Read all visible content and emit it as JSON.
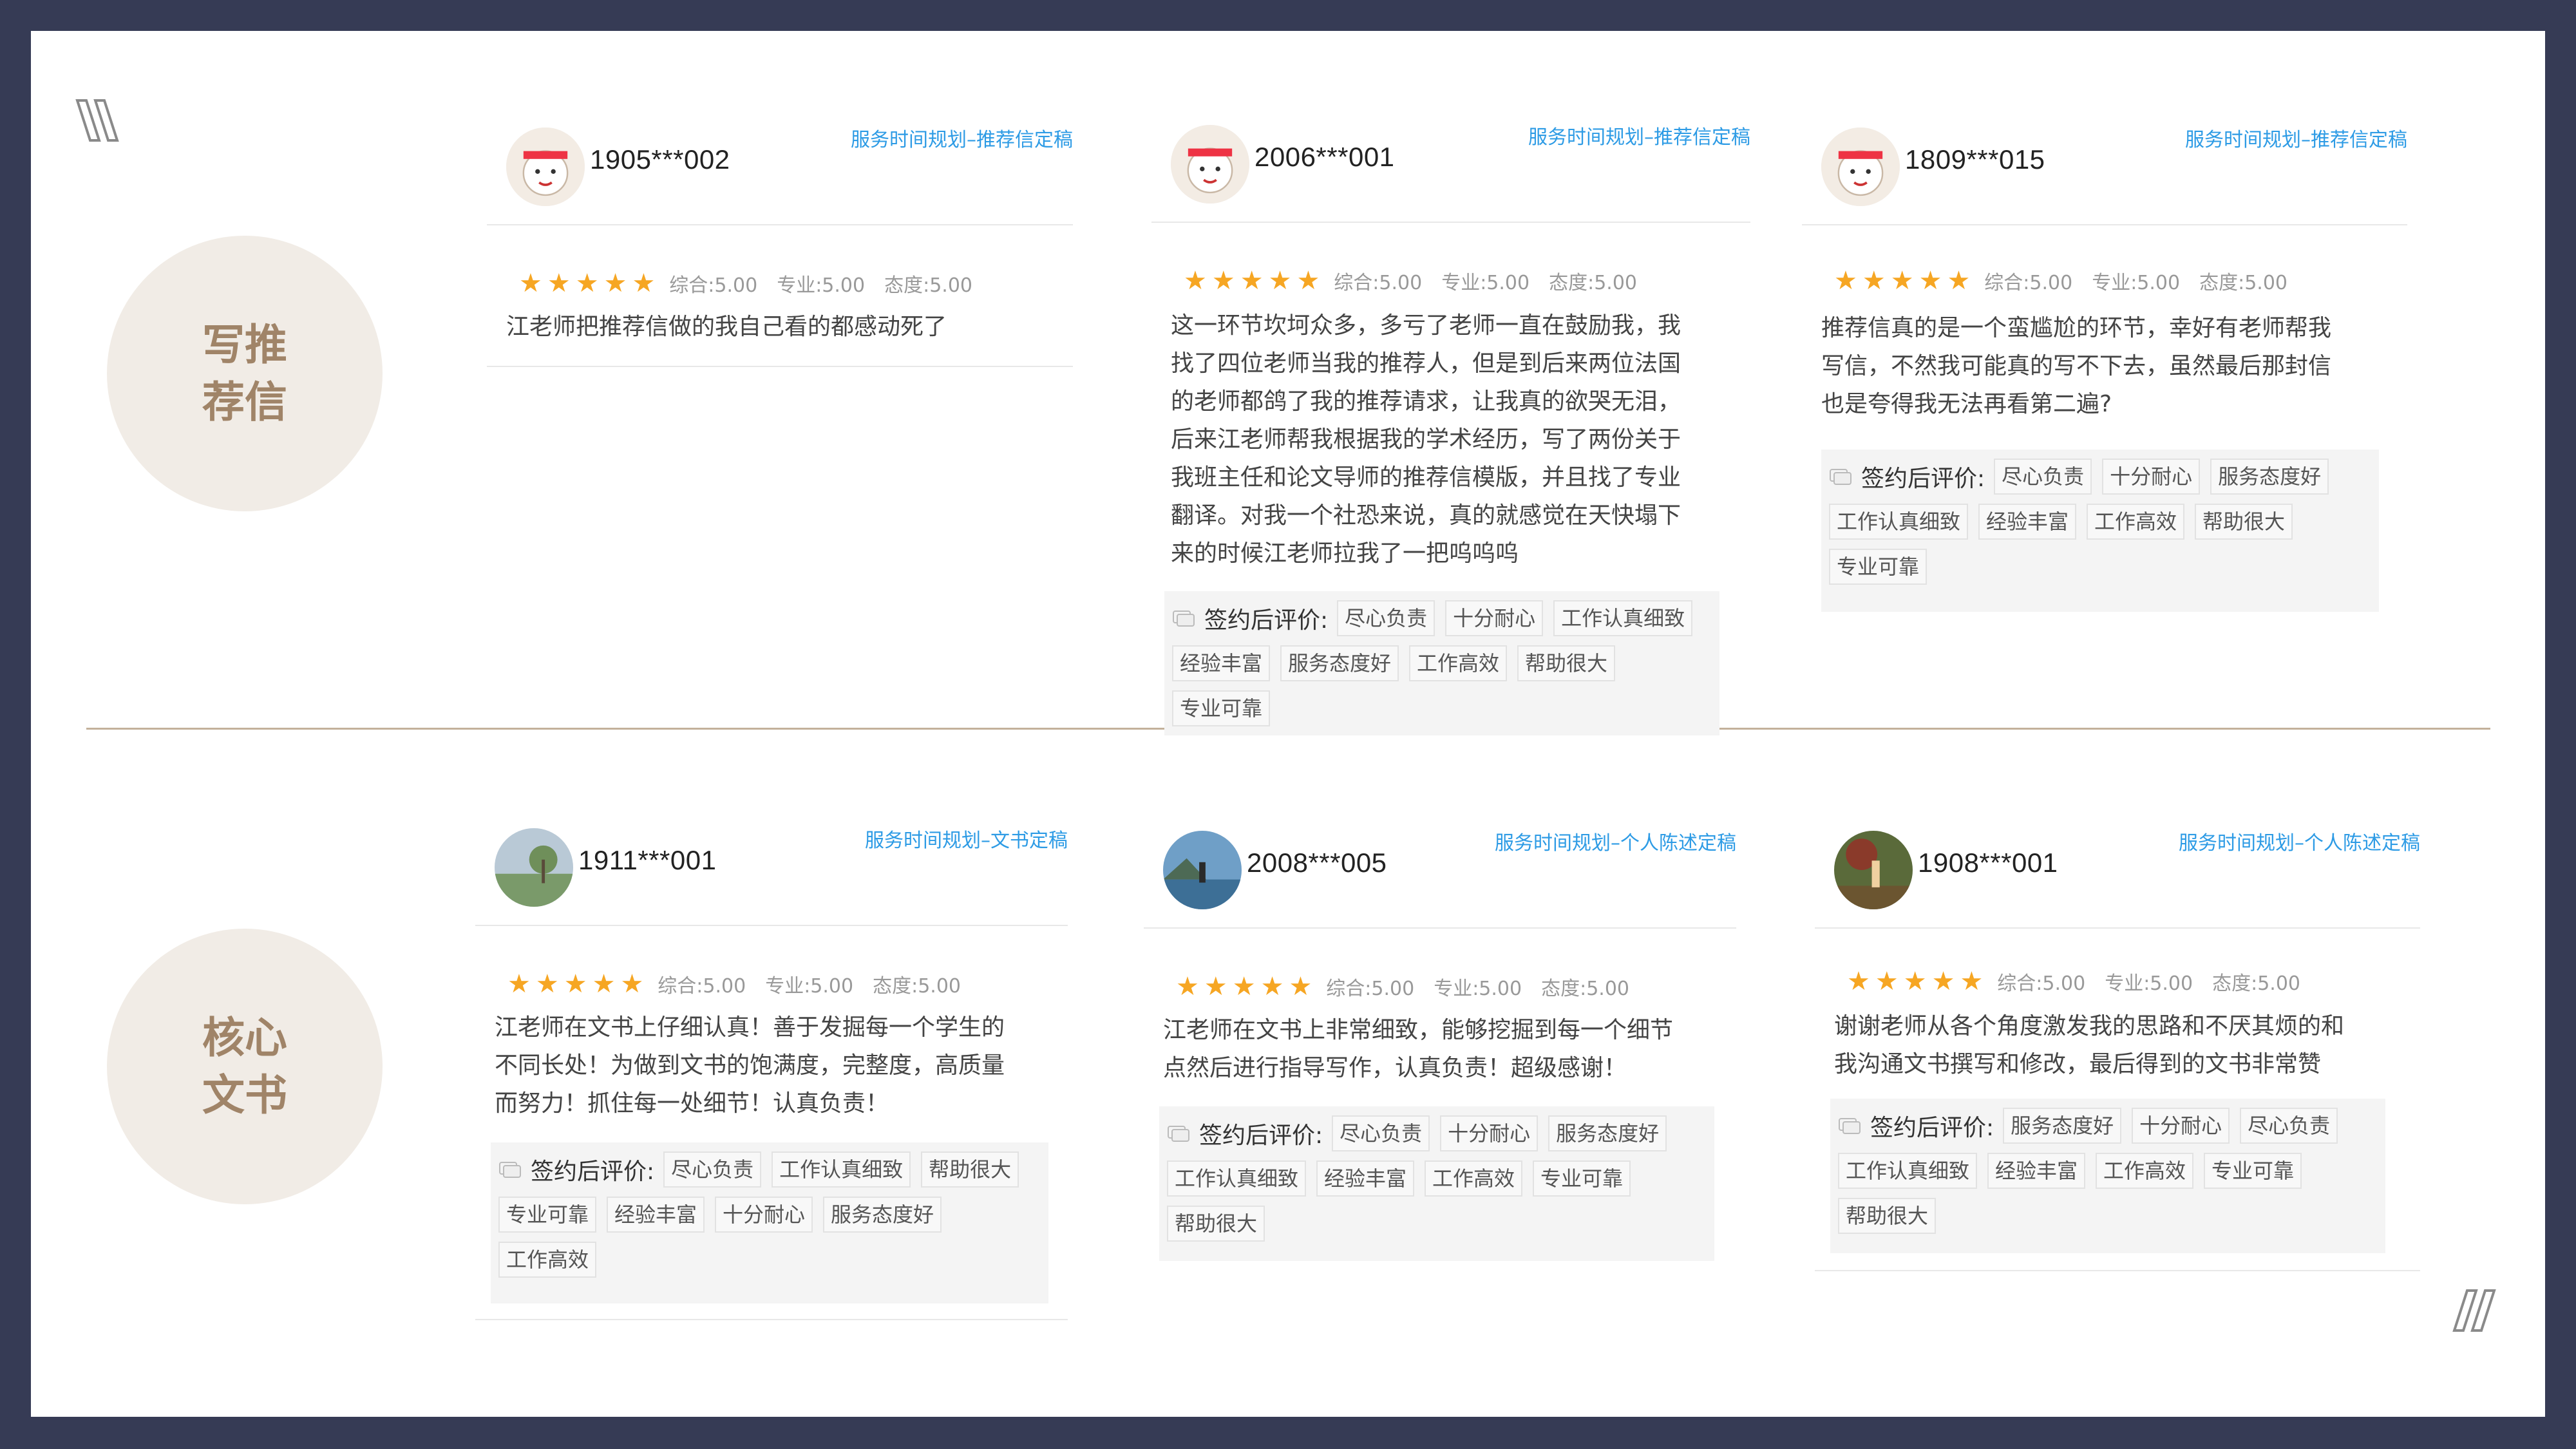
{
  "sections": [
    {
      "label": "写推荐信",
      "cards": [
        {
          "user_id": "1905***002",
          "service": "服务时间规划–推荐信定稿",
          "scores": [
            "综合:5.00",
            "专业:5.00",
            "态度:5.00"
          ],
          "rating": 5,
          "review": [
            "江老师把推荐信做的我自己看的都感动死了"
          ],
          "tags_label": "",
          "tags": []
        },
        {
          "user_id": "2006***001",
          "service": "服务时间规划–推荐信定稿",
          "scores": [
            "综合:5.00",
            "专业:5.00",
            "态度:5.00"
          ],
          "rating": 5,
          "review": [
            "这一环节坎坷众多，多亏了老师一直在鼓励我，我",
            "找了四位老师当我的推荐人，但是到后来两位法国",
            "的老师都鸽了我的推荐请求，让我真的欲哭无泪，",
            "后来江老师帮我根据我的学术经历，写了两份关于",
            "我班主任和论文导师的推荐信模版，并且找了专业",
            "翻译。对我一个社恐来说，真的就感觉在天快塌下",
            "来的时候江老师拉我了一把呜呜呜"
          ],
          "tags_label": "签约后评价:",
          "tags": [
            "尽心负责",
            "十分耐心",
            "工作认真细致",
            "经验丰富",
            "服务态度好",
            "工作高效",
            "帮助很大",
            "专业可靠"
          ]
        },
        {
          "user_id": "1809***015",
          "service": "服务时间规划–推荐信定稿",
          "scores": [
            "综合:5.00",
            "专业:5.00",
            "态度:5.00"
          ],
          "rating": 5,
          "review": [
            "推荐信真的是一个蛮尴尬的环节，幸好有老师帮我",
            "写信，不然我可能真的写不下去，虽然最后那封信",
            "也是夸得我无法再看第二遍?"
          ],
          "tags_label": "签约后评价:",
          "tags": [
            "尽心负责",
            "十分耐心",
            "服务态度好",
            "工作认真细致",
            "经验丰富",
            "工作高效",
            "帮助很大",
            "专业可靠"
          ]
        }
      ]
    },
    {
      "label": "核心文书",
      "cards": [
        {
          "user_id": "1911***001",
          "service": "服务时间规划–文书定稿",
          "scores": [
            "综合:5.00",
            "专业:5.00",
            "态度:5.00"
          ],
          "rating": 5,
          "review": [
            "江老师在文书上仔细认真！善于发掘每一个学生的",
            "不同长处！为做到文书的饱满度，完整度，高质量",
            "而努力！抓住每一处细节！认真负责！"
          ],
          "tags_label": "签约后评价:",
          "tags": [
            "尽心负责",
            "工作认真细致",
            "帮助很大",
            "专业可靠",
            "经验丰富",
            "十分耐心",
            "服务态度好",
            "工作高效"
          ]
        },
        {
          "user_id": "2008***005",
          "service": "服务时间规划–个人陈述定稿",
          "scores": [
            "综合:5.00",
            "专业:5.00",
            "态度:5.00"
          ],
          "rating": 5,
          "review": [
            "江老师在文书上非常细致，能够挖掘到每一个细节",
            "点然后进行指导写作，认真负责！超级感谢！"
          ],
          "tags_label": "签约后评价:",
          "tags": [
            "尽心负责",
            "十分耐心",
            "服务态度好",
            "工作认真细致",
            "经验丰富",
            "工作高效",
            "专业可靠",
            "帮助很大"
          ]
        },
        {
          "user_id": "1908***001",
          "service": "服务时间规划–个人陈述定稿",
          "scores": [
            "综合:5.00",
            "专业:5.00",
            "态度:5.00"
          ],
          "rating": 5,
          "review": [
            "谢谢老师从各个角度激发我的思路和不厌其烦的和",
            "我沟通文书撰写和修改，最后得到的文书非常赞"
          ],
          "tags_label": "签约后评价:",
          "tags": [
            "服务态度好",
            "十分耐心",
            "尽心负责",
            "工作认真细致",
            "经验丰富",
            "工作高效",
            "专业可靠",
            "帮助很大"
          ]
        }
      ]
    }
  ],
  "colors": {
    "frame": "#363b55",
    "accent": "#a08468",
    "star": "#f6a623",
    "service": "#2d9be5"
  }
}
